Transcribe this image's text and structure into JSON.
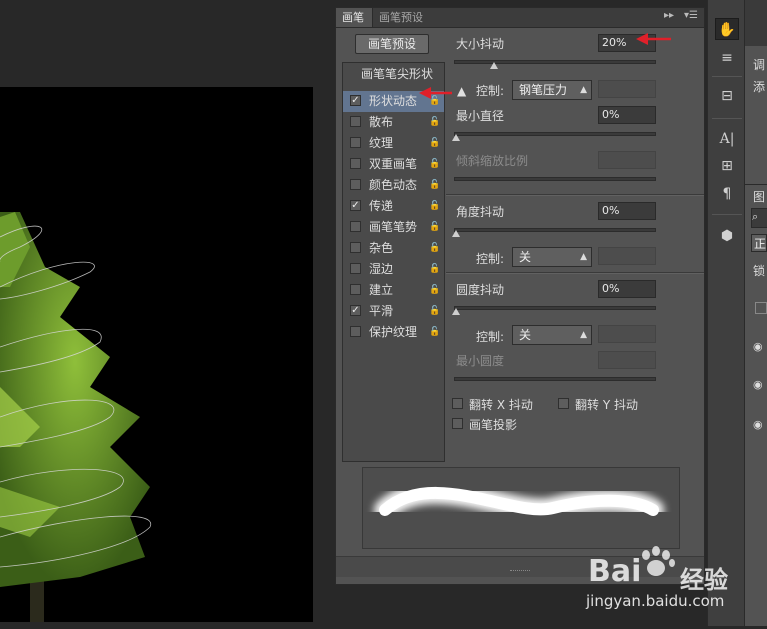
{
  "tabs": [
    {
      "label": "画笔",
      "active": true
    },
    {
      "label": "画笔预设",
      "active": false
    }
  ],
  "presets_button": "画笔预设",
  "brush_tip_header": "画笔笔尖形状",
  "list_items": [
    {
      "label": "形状动态",
      "checked": true,
      "selected": true
    },
    {
      "label": "散布",
      "checked": false
    },
    {
      "label": "纹理",
      "checked": false
    },
    {
      "label": "双重画笔",
      "checked": false
    },
    {
      "label": "颜色动态",
      "checked": false
    },
    {
      "label": "传递",
      "checked": true
    },
    {
      "label": "画笔笔势",
      "checked": false
    },
    {
      "label": "杂色",
      "checked": false
    },
    {
      "label": "湿边",
      "checked": false
    },
    {
      "label": "建立",
      "checked": false
    },
    {
      "label": "平滑",
      "checked": true
    },
    {
      "label": "保护纹理",
      "checked": false
    }
  ],
  "settings": {
    "size_jitter_label": "大小抖动",
    "size_jitter_value": "20%",
    "size_jitter_level": 0.2,
    "control_label": "控制:",
    "control_value": "钢笔压力",
    "min_diameter_label": "最小直径",
    "min_diameter_value": "0%",
    "tilt_scale_label": "倾斜缩放比例",
    "angle_jitter_label": "角度抖动",
    "angle_jitter_value": "0%",
    "angle_control_label": "控制:",
    "angle_control_value": "关",
    "roundness_jitter_label": "圆度抖动",
    "roundness_jitter_value": "0%",
    "roundness_control_label": "控制:",
    "roundness_control_value": "关",
    "min_roundness_label": "最小圆度",
    "flip_x_label": "翻转 X 抖动",
    "flip_y_label": "翻转 Y 抖动",
    "brush_projection_label": "画笔投影"
  },
  "right_panel_text": [
    "调",
    "添",
    "图",
    "正",
    "锁"
  ],
  "watermark": {
    "brand": "Bai",
    "brand2": "经验",
    "url": "jingyan.baidu.com"
  },
  "colors": {
    "selection": "#627590",
    "annotation_arrow": "#e0202a"
  }
}
